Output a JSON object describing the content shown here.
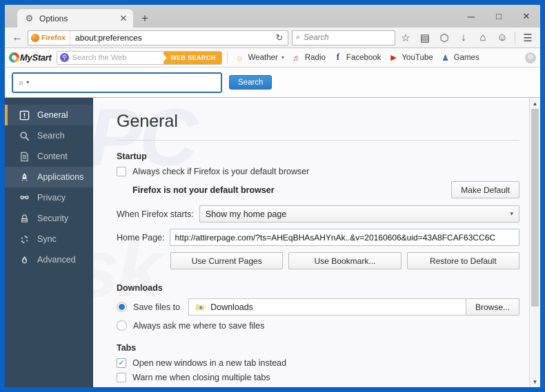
{
  "window": {
    "minimize_label": "─",
    "maximize_label": "□",
    "close_label": "✕"
  },
  "tabs": {
    "active": {
      "title": "Options",
      "favicon": "gear-icon",
      "close_label": "✕"
    },
    "newtab_label": "+"
  },
  "navbar": {
    "back_label": "←",
    "identity_label": "Firefox",
    "url": "about:preferences",
    "reload_label": "↻",
    "search_placeholder": "Search",
    "search_icon_label": "⌕",
    "icons": [
      {
        "name": "bookmark-star-icon",
        "glyph": "☆"
      },
      {
        "name": "reader-list-icon",
        "glyph": "▤"
      },
      {
        "name": "pocket-icon",
        "glyph": "⬡"
      },
      {
        "name": "downloads-icon",
        "glyph": "↓"
      },
      {
        "name": "home-icon",
        "glyph": "⌂"
      },
      {
        "name": "feedback-smiley-icon",
        "glyph": "☺"
      },
      {
        "name": "menu-hamburger-icon",
        "glyph": "☰"
      }
    ]
  },
  "mystart": {
    "logo_text": "MyStart",
    "search_placeholder": "Search the Web",
    "web_search_label": "WEB SEARCH",
    "items": [
      {
        "name": "weather",
        "label": "Weather",
        "icon": "sun-icon",
        "glyph": "☀",
        "caret": "▾",
        "color": "#f0ac2a"
      },
      {
        "name": "radio",
        "label": "Radio",
        "icon": "headphones-icon",
        "glyph": "♫",
        "color": "#e0427f"
      },
      {
        "name": "facebook",
        "label": "Facebook",
        "icon": "facebook-icon",
        "glyph": "f",
        "color": "#3b5998"
      },
      {
        "name": "youtube",
        "label": "YouTube",
        "icon": "tv-icon",
        "glyph": "▶",
        "color": "#e02222"
      },
      {
        "name": "games",
        "label": "Games",
        "icon": "joystick-icon",
        "glyph": "♟",
        "color": "#4a6fa5"
      }
    ],
    "settings_glyph": "⚙"
  },
  "bigsearch": {
    "query": "",
    "magnifier_glyph": "⌕",
    "caret_glyph": "▾",
    "button_label": "Search"
  },
  "sidebar": {
    "items": [
      {
        "label": "General",
        "icon": "general-icon",
        "state": "selected"
      },
      {
        "label": "Search",
        "icon": "search-icon",
        "state": "normal"
      },
      {
        "label": "Content",
        "icon": "content-icon",
        "state": "normal"
      },
      {
        "label": "Applications",
        "icon": "applications-icon",
        "state": "hover"
      },
      {
        "label": "Privacy",
        "icon": "privacy-mask-icon",
        "state": "normal"
      },
      {
        "label": "Security",
        "icon": "security-lock-icon",
        "state": "normal"
      },
      {
        "label": "Sync",
        "icon": "sync-icon",
        "state": "normal"
      },
      {
        "label": "Advanced",
        "icon": "advanced-icon",
        "state": "normal"
      }
    ],
    "accent_color": "#e8a33d",
    "bg_color": "#35495c"
  },
  "main": {
    "title": "General",
    "startup": {
      "heading": "Startup",
      "default_browser_checkbox": {
        "label": "Always check if Firefox is your default browser",
        "checked": false
      },
      "not_default_note": "Firefox is not your default browser",
      "make_default_label": "Make Default",
      "when_starts_label": "When Firefox starts:",
      "when_starts_value": "Show my home page",
      "when_starts_caret": "▾",
      "home_page_label": "Home Page:",
      "home_page_value": "http://attirerpage.com/?ts=AHEqBHAsAHYnAk..&v=20160606&uid=43A8FCAF63CC6C",
      "buttons": [
        "Use Current Pages",
        "Use Bookmark...",
        "Restore to Default"
      ]
    },
    "downloads": {
      "heading": "Downloads",
      "save_files_to_label": "Save files to",
      "save_files_to_selected": true,
      "folder_name": "Downloads",
      "browse_label": "Browse...",
      "always_ask_label": "Always ask me where to save files",
      "always_ask_selected": false
    },
    "tabs_section": {
      "heading": "Tabs",
      "options": [
        {
          "label": "Open new windows in a new tab instead",
          "checked": true
        },
        {
          "label": "Warn me when closing multiple tabs",
          "checked": false
        }
      ]
    }
  },
  "scrollbar": {
    "up_glyph": "▲",
    "down_glyph": "▼"
  }
}
